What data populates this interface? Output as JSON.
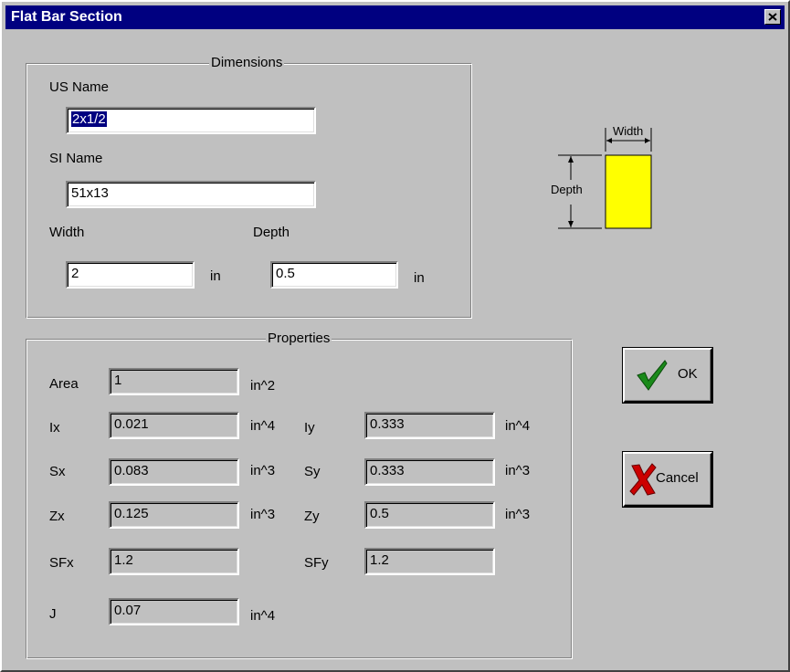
{
  "window": {
    "title": "Flat Bar Section"
  },
  "dimensions": {
    "legend": "Dimensions",
    "us_name_label": "US Name",
    "us_name_value": "2x1/2",
    "si_name_label": "SI Name",
    "si_name_value": "51x13",
    "width_label": "Width",
    "width_value": "2",
    "width_unit": "in",
    "depth_label": "Depth",
    "depth_value": "0.5",
    "depth_unit": "in"
  },
  "diagram": {
    "width_label": "Width",
    "depth_label": "Depth",
    "fill_color": "#ffff00"
  },
  "properties": {
    "legend": "Properties",
    "area_label": "Area",
    "area_value": "1",
    "area_unit": "in^2",
    "ix_label": "Ix",
    "ix_value": "0.021",
    "ix_unit": "in^4",
    "iy_label": "Iy",
    "iy_value": "0.333",
    "iy_unit": "in^4",
    "sx_label": "Sx",
    "sx_value": "0.083",
    "sx_unit": "in^3",
    "sy_label": "Sy",
    "sy_value": "0.333",
    "sy_unit": "in^3",
    "zx_label": "Zx",
    "zx_value": "0.125",
    "zx_unit": "in^3",
    "zy_label": "Zy",
    "zy_value": "0.5",
    "zy_unit": "in^3",
    "sfx_label": "SFx",
    "sfx_value": "1.2",
    "sfy_label": "SFy",
    "sfy_value": "1.2",
    "j_label": "J",
    "j_value": "0.07",
    "j_unit": "in^4"
  },
  "buttons": {
    "ok_label": "OK",
    "cancel_label": "Cancel"
  },
  "icons": {
    "ok": "checkmark-icon",
    "cancel": "x-icon",
    "close": "close-icon"
  },
  "colors": {
    "titlebar": "#000080",
    "ok_check": "#1a8a1a",
    "cancel_x": "#cc0000"
  }
}
